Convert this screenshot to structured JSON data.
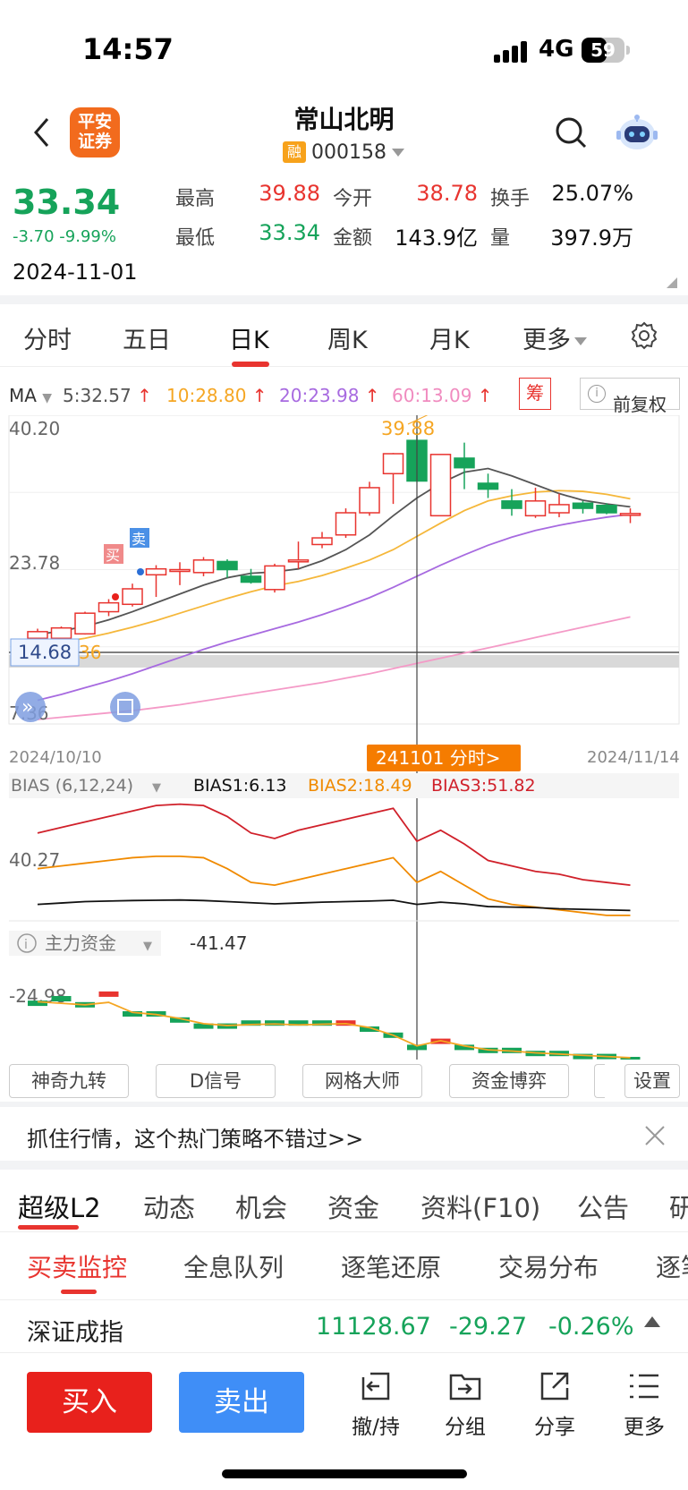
{
  "status_bar": {
    "time": "14:57",
    "network": "4G",
    "battery": "59",
    "battery_level": 0.59
  },
  "header": {
    "logo_line1": "平安",
    "logo_line2": "证券",
    "stock_name": "常山北明",
    "margin_badge": "融",
    "stock_code": "000158"
  },
  "quote": {
    "price": "33.34",
    "change": "-3.70 -9.99%",
    "date": "2024-11-01",
    "fields": [
      {
        "label": "最高",
        "value": "39.88",
        "color": "#e8342f"
      },
      {
        "label": "今开",
        "value": "38.78",
        "color": "#e8342f"
      },
      {
        "label": "换手",
        "value": "25.07%",
        "color": "#111111"
      },
      {
        "label": "最低",
        "value": "33.34",
        "color": "#16a35a"
      },
      {
        "label": "金额",
        "value": "143.9亿",
        "color": "#111111"
      },
      {
        "label": "量",
        "value": "397.9万",
        "color": "#111111"
      }
    ]
  },
  "period_tabs": [
    "分时",
    "五日",
    "日K",
    "周K",
    "月K",
    "更多"
  ],
  "ma_bar": {
    "label": "MA",
    "ma5": "5:32.57",
    "ma10": "10:28.80",
    "ma20": "20:23.98",
    "ma60": "60:13.09",
    "chou": "筹",
    "fuquan": "前复权"
  },
  "chart_data": {
    "type": "candlestick",
    "price_axis": {
      "top": "40.20",
      "mid": "23.78",
      "bottom": "7.36",
      "crosshair_price": "14.68",
      "crosshair_label_overlap": "36"
    },
    "high_marker": "39.88",
    "date_start": "2024/10/10",
    "date_end": "2024/11/14",
    "crosshair_date": "241101 分时>",
    "buy_label": "买",
    "sell_label": "卖",
    "candles": [
      {
        "o": 12.0,
        "c": 12.9,
        "h": 13.3,
        "l": 11.4
      },
      {
        "o": 12.0,
        "c": 13.4,
        "h": 13.6,
        "l": 11.5
      },
      {
        "o": 12.6,
        "c": 15.4,
        "h": 15.6,
        "l": 12.5
      },
      {
        "o": 15.6,
        "c": 16.8,
        "h": 17.3,
        "l": 15.0
      },
      {
        "o": 16.6,
        "c": 18.7,
        "h": 19.4,
        "l": 16.3
      },
      {
        "o": 20.6,
        "c": 21.4,
        "h": 21.9,
        "l": 17.6
      },
      {
        "o": 21.3,
        "c": 21.3,
        "h": 22.3,
        "l": 19.2
      },
      {
        "o": 20.9,
        "c": 22.6,
        "h": 23.0,
        "l": 20.4
      },
      {
        "o": 22.4,
        "c": 21.3,
        "h": 22.7,
        "l": 20.2
      },
      {
        "o": 20.4,
        "c": 19.6,
        "h": 21.4,
        "l": 19.4
      },
      {
        "o": 18.6,
        "c": 21.8,
        "h": 22.1,
        "l": 18.2
      },
      {
        "o": 22.4,
        "c": 22.6,
        "h": 25.1,
        "l": 21.4
      },
      {
        "o": 24.7,
        "c": 25.6,
        "h": 26.4,
        "l": 24.2
      },
      {
        "o": 26.0,
        "c": 29.0,
        "h": 29.6,
        "l": 25.6
      },
      {
        "o": 29.0,
        "c": 32.4,
        "h": 33.2,
        "l": 28.6
      },
      {
        "o": 34.3,
        "c": 37.0,
        "h": 37.1,
        "l": 30.2
      },
      {
        "o": 38.8,
        "c": 33.3,
        "h": 39.9,
        "l": 33.3
      },
      {
        "o": 28.6,
        "c": 36.9,
        "h": 36.9,
        "l": 28.6
      },
      {
        "o": 36.4,
        "c": 35.1,
        "h": 38.5,
        "l": 32.2
      },
      {
        "o": 33.0,
        "c": 32.2,
        "h": 34.3,
        "l": 31.0
      },
      {
        "o": 30.6,
        "c": 29.6,
        "h": 32.2,
        "l": 28.6
      },
      {
        "o": 28.6,
        "c": 30.6,
        "h": 32.4,
        "l": 28.3
      },
      {
        "o": 29.0,
        "c": 30.1,
        "h": 31.6,
        "l": 28.4
      },
      {
        "o": 30.3,
        "c": 29.6,
        "h": 30.6,
        "l": 28.9
      },
      {
        "o": 30.0,
        "c": 29.0,
        "h": 30.3,
        "l": 28.8
      },
      {
        "o": 28.8,
        "c": 28.9,
        "h": 29.6,
        "l": 27.6
      }
    ],
    "ma5": [
      12.5,
      13.0,
      13.6,
      14.5,
      15.6,
      16.8,
      18.0,
      19.2,
      20.2,
      20.8,
      21.0,
      21.4,
      22.5,
      24.0,
      26.0,
      28.6,
      31.0,
      33.0,
      34.5,
      35.0,
      34.0,
      32.8,
      31.6,
      30.7,
      30.2,
      29.8
    ],
    "ma10": [
      11.0,
      11.5,
      12.0,
      12.7,
      13.5,
      14.4,
      15.4,
      16.4,
      17.4,
      18.3,
      19.1,
      19.7,
      20.5,
      21.5,
      22.6,
      24.0,
      25.8,
      27.6,
      29.3,
      30.6,
      31.3,
      31.8,
      32.0,
      31.9,
      31.5,
      30.9
    ],
    "ma20": [
      3.6,
      4.4,
      5.3,
      6.2,
      7.2,
      8.3,
      9.4,
      10.5,
      11.5,
      12.4,
      13.3,
      14.2,
      15.2,
      16.3,
      17.5,
      18.9,
      20.4,
      21.9,
      23.3,
      24.6,
      25.7,
      26.6,
      27.3,
      27.9,
      28.4,
      28.8
    ],
    "ma60": [
      1.0,
      1.3,
      1.6,
      1.9,
      2.2,
      2.6,
      3.0,
      3.5,
      4.0,
      4.5,
      5.0,
      5.5,
      6.0,
      6.6,
      7.2,
      7.9,
      8.6,
      9.3,
      10.0,
      10.7,
      11.4,
      12.1,
      12.8,
      13.5,
      14.2,
      14.9
    ],
    "bias": {
      "label": "BIAS (6,12,24)",
      "b1_text": "BIAS1:6.13",
      "b2_text": "BIAS2:18.49",
      "b3_text": "BIAS3:51.82",
      "axis_label": "40.27",
      "b1": [
        26,
        26.5,
        27,
        27.2,
        27.4,
        27.5,
        27.6,
        27.4,
        27.0,
        26.6,
        26.2,
        26.5,
        26.8,
        27.0,
        27.2,
        27.5,
        26.0,
        26.8,
        26.2,
        25.2,
        25.0,
        24.8,
        24.4,
        24.2,
        24.0,
        23.8
      ],
      "b3": [
        52,
        54,
        56,
        58,
        60,
        62,
        62.5,
        62,
        58,
        52,
        50,
        53,
        55,
        57,
        59,
        61,
        49,
        53,
        48,
        42,
        40,
        38,
        37,
        35,
        34,
        33
      ],
      "b2": [
        39,
        40,
        41,
        42,
        43,
        43.5,
        43.5,
        43,
        39,
        34,
        33,
        35,
        37,
        39,
        41,
        43,
        34,
        38,
        33,
        28,
        26,
        25,
        24,
        23,
        22,
        22
      ]
    },
    "fund": {
      "label": "主力资金",
      "value": "-41.47",
      "axis_label": "-24.98",
      "bars": [
        -1.5,
        0,
        -2,
        1.5,
        -5,
        -5,
        -7,
        -9,
        -9,
        -8,
        -8,
        -8,
        -8,
        -8,
        -10,
        -12,
        -16,
        -14,
        -16,
        -17,
        -17,
        -18,
        -18,
        -19,
        -19,
        -20
      ],
      "line": [
        -1,
        -1.5,
        -2,
        -1.2,
        -4.5,
        -5.2,
        -6.5,
        -8.2,
        -8.8,
        -8.5,
        -8.3,
        -8.6,
        -8.4,
        -8.2,
        -9.5,
        -12,
        -15.5,
        -13.8,
        -15.5,
        -16.8,
        -17.2,
        -17.8,
        -18.2,
        -18.6,
        -19,
        -19.4
      ]
    }
  },
  "strategy_buttons": [
    "神奇九转",
    "D信号",
    "网格大师",
    "资金博弈",
    "",
    "设置"
  ],
  "promo": {
    "text": "抓住行情，这个热门策略不错过>>"
  },
  "info_tabs": [
    "超级L2",
    "动态",
    "机会",
    "资金",
    "资料(F10)",
    "公告",
    "研"
  ],
  "sub_tabs": [
    "买卖监控",
    "全息队列",
    "逐笔还原",
    "交易分布",
    "逐笔"
  ],
  "index": {
    "name": "深证成指",
    "value": "11128.67",
    "change": "-29.27",
    "pct": "-0.26%"
  },
  "actions": {
    "buy": "买入",
    "sell": "卖出",
    "cancel": "撤/持",
    "group": "分组",
    "share": "分享",
    "more": "更多"
  },
  "colors": {
    "up": "#e8342f",
    "down": "#16a35a",
    "ma5": "#555555",
    "ma10": "#f5b73a",
    "ma20": "#a76ae0",
    "ma60": "#f49ac7"
  }
}
